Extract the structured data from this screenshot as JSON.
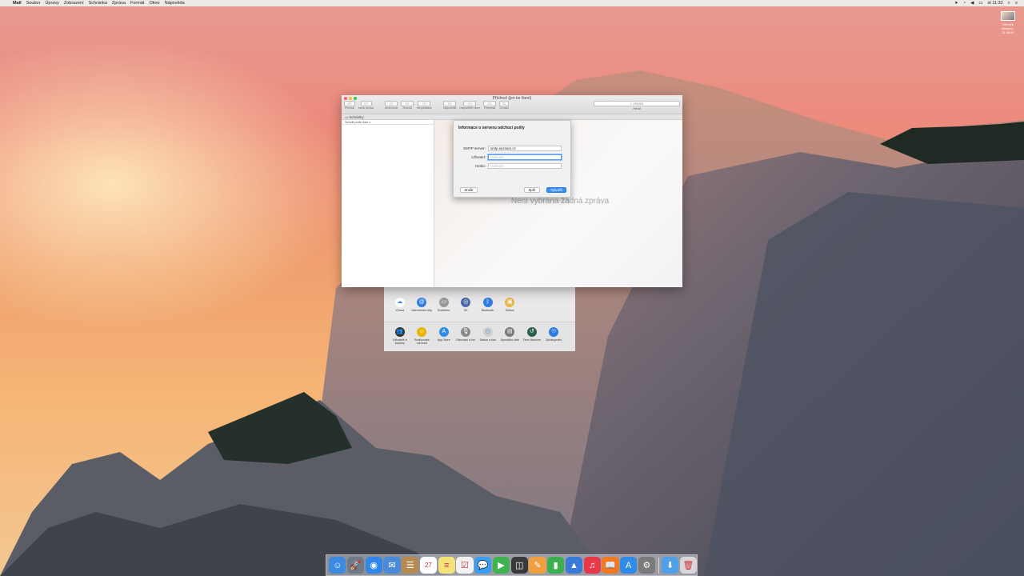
{
  "menubar": {
    "apple": "",
    "items": [
      "Mail",
      "Soubor",
      "Úpravy",
      "Zobrazení",
      "Schránka",
      "Zpráva",
      "Formát",
      "Okno",
      "Nápověda"
    ],
    "clock": "st 11:32"
  },
  "desktop_icon": {
    "label_line1": "Snímek",
    "label_line2": "obrazov... 11.36.51"
  },
  "mail_window": {
    "title": "Příchozí (jen ke čtení)",
    "toolbar": [
      {
        "icon": "envelope-icon",
        "label": "Příchozí"
      },
      {
        "icon": "compose-icon",
        "label": "Nová zpráva"
      },
      {
        "icon": "archive-icon",
        "label": "Archivovat"
      },
      {
        "icon": "trash-icon",
        "label": "Smazat"
      },
      {
        "icon": "junk-icon",
        "label": "Nevyžádané"
      },
      {
        "icon": "reply-icon",
        "label": "Odpovědět"
      },
      {
        "icon": "reply-all-icon",
        "label": "Odpovědět všem"
      },
      {
        "icon": "forward-icon",
        "label": "Přeposlat"
      },
      {
        "icon": "flag-icon",
        "label": "Označit"
      }
    ],
    "search_placeholder": "Hledat",
    "search_label": "Hledat",
    "favorites": "Schránky",
    "sort_label": "Seřadit podle data ∨",
    "no_message": "Není vybrána žádná zpráva"
  },
  "dialog": {
    "title": "Informace o serveru odchozí pošty",
    "smtp_label": "SMTP server:",
    "smtp_value": "smtp.seznam.cz",
    "user_label": "Uživatel:",
    "user_placeholder": "Volitelné",
    "password_label": "Heslo:",
    "password_placeholder": "Volitelné",
    "cancel": "Zrušit",
    "back": "Zpět",
    "create": "Vytvořit"
  },
  "sysprefs": {
    "row1": [
      {
        "label": "iCloud",
        "color": "#ffffff",
        "glyph": "☁"
      },
      {
        "label": "Internetové účty",
        "color": "#2f7de1",
        "glyph": "@"
      },
      {
        "label": "Rozšíření",
        "color": "#9a9a9a",
        "glyph": "▭"
      },
      {
        "label": "Síť",
        "color": "#4a6aa8",
        "glyph": "◎"
      },
      {
        "label": "Bluetooth",
        "color": "#2f7de1",
        "glyph": "ᛒ"
      },
      {
        "label": "Sdílení",
        "color": "#e8b84a",
        "glyph": "▣"
      }
    ],
    "row2": [
      {
        "label": "Uživatelé a skupiny",
        "color": "#333333",
        "glyph": "👥"
      },
      {
        "label": "Rodičovská ochrana",
        "color": "#e8b400",
        "glyph": "☺"
      },
      {
        "label": "App Store",
        "color": "#2f8ae8",
        "glyph": "A"
      },
      {
        "label": "Diktování a řeč",
        "color": "#8a8a8a",
        "glyph": "🎙"
      },
      {
        "label": "Datum a čas",
        "color": "#d0d0d0",
        "glyph": "◷"
      },
      {
        "label": "Spouštěcí disk",
        "color": "#7a7a7a",
        "glyph": "▤"
      },
      {
        "label": "Time Machine",
        "color": "#2e5e4e",
        "glyph": "↺"
      },
      {
        "label": "Zpřístupnění",
        "color": "#2f7de1",
        "glyph": "☉"
      }
    ]
  },
  "dock": [
    {
      "name": "finder-icon",
      "color": "#3c8be0",
      "glyph": "☺"
    },
    {
      "name": "launchpad-icon",
      "color": "#707a86",
      "glyph": "🚀"
    },
    {
      "name": "safari-icon",
      "color": "#2f88e8",
      "glyph": "◉"
    },
    {
      "name": "mail-app-icon",
      "color": "#4a8ad8",
      "glyph": "✉"
    },
    {
      "name": "contacts-icon",
      "color": "#b88a50",
      "glyph": "☰"
    },
    {
      "name": "calendar-icon",
      "color": "#ffffff",
      "glyph": "27"
    },
    {
      "name": "notes-icon",
      "color": "#f4e27a",
      "glyph": "≡"
    },
    {
      "name": "reminders-icon",
      "color": "#f2f2f2",
      "glyph": "☑"
    },
    {
      "name": "messages-icon",
      "color": "#3b9cf3",
      "glyph": "💬"
    },
    {
      "name": "facetime-icon",
      "color": "#3fb34f",
      "glyph": "▶"
    },
    {
      "name": "photo-booth-icon",
      "color": "#3a3a3a",
      "glyph": "◫"
    },
    {
      "name": "pages-icon",
      "color": "#f0a040",
      "glyph": "✎"
    },
    {
      "name": "numbers-icon",
      "color": "#3cb050",
      "glyph": "▮"
    },
    {
      "name": "keynote-icon",
      "color": "#3a7ad8",
      "glyph": "▲"
    },
    {
      "name": "itunes-icon",
      "color": "#e8384a",
      "glyph": "♫"
    },
    {
      "name": "ibooks-icon",
      "color": "#f07a20",
      "glyph": "📖"
    },
    {
      "name": "app-store-icon",
      "color": "#2f8ae8",
      "glyph": "A"
    },
    {
      "name": "system-preferences-icon",
      "color": "#7a7a7a",
      "glyph": "⚙"
    },
    {
      "name": "downloads-folder-icon",
      "color": "#4ea0e8",
      "glyph": "⬇"
    },
    {
      "name": "trash-icon",
      "color": "#d8d8dc",
      "glyph": "🗑"
    }
  ]
}
